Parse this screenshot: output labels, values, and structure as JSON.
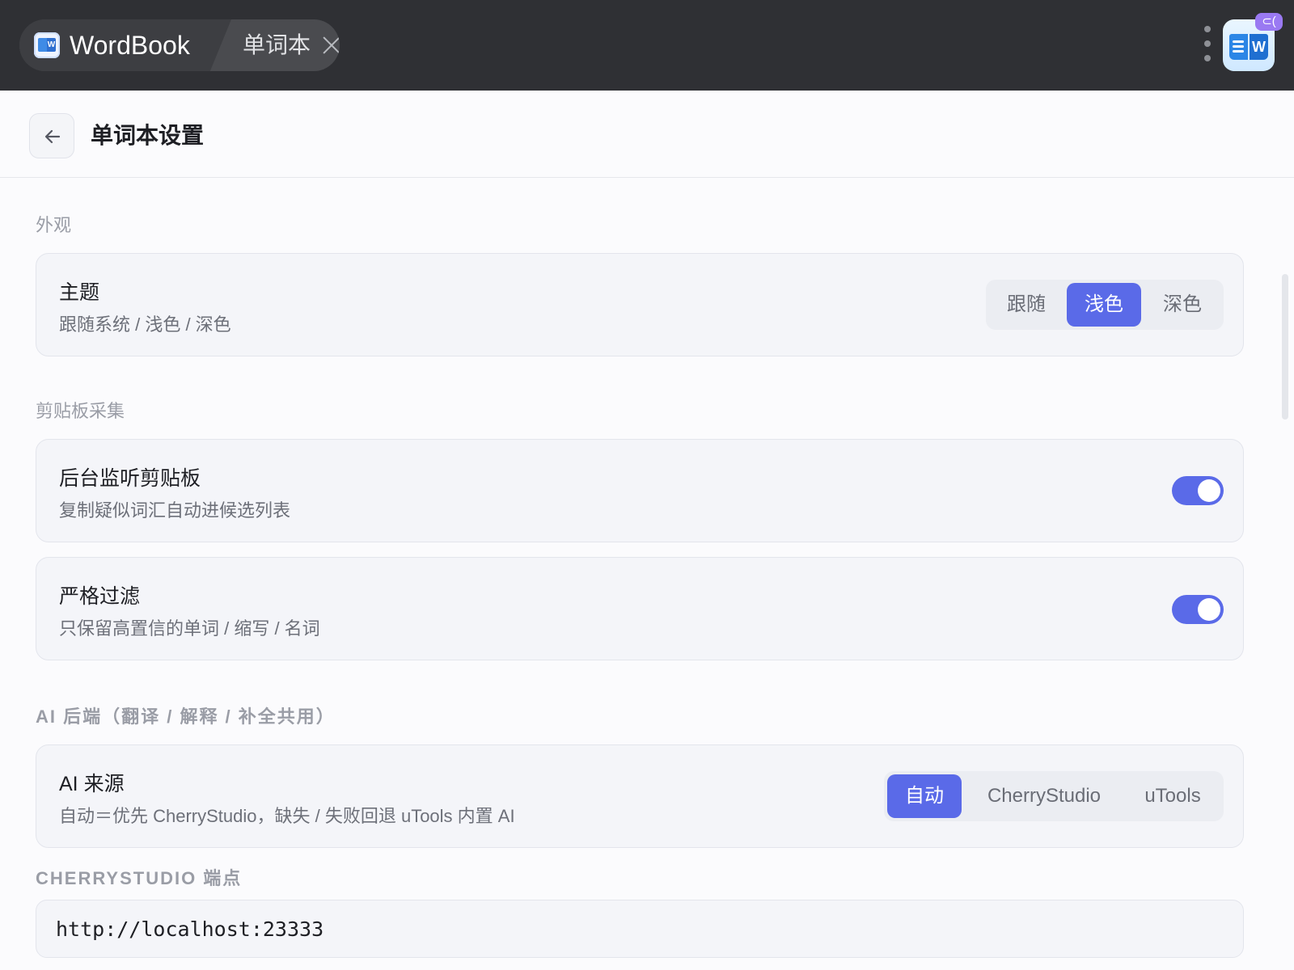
{
  "titlebar": {
    "app_name": "WordBook",
    "tab_label": "单词本",
    "plugin_badge": "⊂("
  },
  "header": {
    "title": "单词本设置"
  },
  "sections": {
    "appearance": {
      "title": "外观",
      "theme": {
        "title": "主题",
        "desc": "跟随系统 / 浅色 / 深色",
        "options": [
          "跟随",
          "浅色",
          "深色"
        ],
        "selected": "浅色"
      }
    },
    "clipboard": {
      "title": "剪贴板采集",
      "listen": {
        "title": "后台监听剪贴板",
        "desc": "复制疑似词汇自动进候选列表",
        "on": true
      },
      "strict": {
        "title": "严格过滤",
        "desc": "只保留高置信的单词 / 缩写 / 名词",
        "on": true
      }
    },
    "ai": {
      "title": "AI 后端（翻译 / 解释 / 补全共用）",
      "source": {
        "title": "AI 来源",
        "desc": "自动＝优先 CherryStudio，缺失 / 失败回退 uTools 内置 AI",
        "options": [
          "自动",
          "CherryStudio",
          "uTools"
        ],
        "selected": "自动"
      },
      "endpoint": {
        "label": "CHERRYSTUDIO 端点",
        "value": "http://localhost:23333"
      }
    }
  },
  "colors": {
    "accent": "#5a6ae8",
    "titlebar_bg": "#2f3034",
    "page_bg": "#fbfbfd",
    "card_bg": "#f4f5f9"
  },
  "icons": {
    "back": "arrow-left-icon",
    "close": "close-icon",
    "menu": "kebab-menu-icon",
    "logo": "wordbook-logo-icon",
    "plugin": "plugin-badge-icon"
  }
}
